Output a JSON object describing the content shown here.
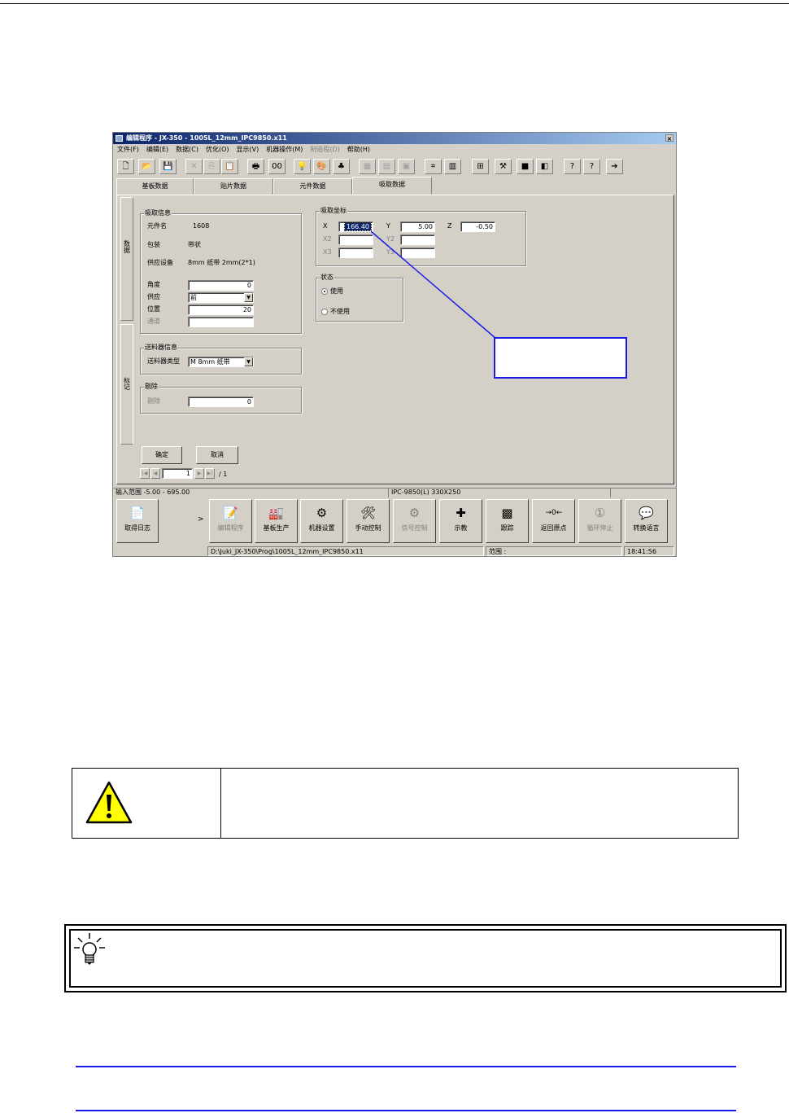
{
  "window": {
    "title": "编辑程序 - JX-350 - 1005L_12mm_IPC9850.x11",
    "close": "×"
  },
  "menu": [
    {
      "label": "文件(F)",
      "enabled": true
    },
    {
      "label": "编辑(E)",
      "enabled": true
    },
    {
      "label": "数据(C)",
      "enabled": true
    },
    {
      "label": "优化(O)",
      "enabled": true
    },
    {
      "label": "显示(V)",
      "enabled": true
    },
    {
      "label": "机器操作(M)",
      "enabled": true
    },
    {
      "label": "制造程(D)",
      "enabled": false
    },
    {
      "label": "帮助(H)",
      "enabled": true
    }
  ],
  "toolbar": [
    {
      "icon": "new-file-icon",
      "glyph": "🗋",
      "enabled": true
    },
    {
      "icon": "open-folder-icon",
      "glyph": "📂",
      "enabled": true
    },
    {
      "icon": "save-icon",
      "glyph": "💾",
      "enabled": true
    },
    {
      "icon": "cut-icon",
      "glyph": "✕",
      "enabled": false
    },
    {
      "icon": "copy-icon",
      "glyph": "⎘",
      "enabled": false
    },
    {
      "icon": "paste-icon",
      "glyph": "📋",
      "enabled": false
    },
    {
      "icon": "print-icon",
      "glyph": "🖶",
      "enabled": true
    },
    {
      "icon": "find-icon",
      "glyph": "00",
      "enabled": true
    },
    {
      "icon": "bulb-icon",
      "glyph": "💡",
      "enabled": true
    },
    {
      "icon": "color-icon",
      "glyph": "🎨",
      "enabled": true
    },
    {
      "icon": "optimize-icon",
      "glyph": "♣",
      "enabled": true
    },
    {
      "icon": "board-icon",
      "glyph": "▦",
      "enabled": false
    },
    {
      "icon": "feeder-icon",
      "glyph": "▤",
      "enabled": false
    },
    {
      "icon": "cube-icon",
      "glyph": "▣",
      "enabled": false
    },
    {
      "icon": "teach-icon",
      "glyph": "⌗",
      "enabled": true
    },
    {
      "icon": "column-icon",
      "glyph": "▥",
      "enabled": true
    },
    {
      "icon": "grid-icon",
      "glyph": "⊞",
      "enabled": true
    },
    {
      "icon": "tool-icon",
      "glyph": "⚒",
      "enabled": true
    },
    {
      "icon": "stop-icon",
      "glyph": "■",
      "enabled": true
    },
    {
      "icon": "layers-icon",
      "glyph": "◧",
      "enabled": true
    },
    {
      "icon": "context-help-icon",
      "glyph": "?",
      "enabled": true
    },
    {
      "icon": "help-icon",
      "glyph": "?",
      "enabled": true
    },
    {
      "icon": "exit-icon",
      "glyph": "➔",
      "enabled": true
    }
  ],
  "tabs": [
    {
      "label": "基板数据",
      "active": false
    },
    {
      "label": "贴片数据",
      "active": false
    },
    {
      "label": "元件数据",
      "active": false
    },
    {
      "label": "吸取数据",
      "active": true
    }
  ],
  "side_tabs": [
    "数据",
    "标记"
  ],
  "pickup_info": {
    "title": "吸取信息",
    "part_name_label": "元件名",
    "part_name_value": "1608",
    "package_label": "包装",
    "package_value": "带状",
    "feeder_device_label": "供应设备",
    "feeder_device_value": "8mm 纸带 2mm(2*1)",
    "angle_label": "角度",
    "angle_value": "0",
    "supply_label": "供应",
    "supply_value": "前",
    "position_label": "位置",
    "position_value": "20",
    "channel_label": "通道",
    "channel_value": ""
  },
  "feeder_info": {
    "title": "送料器信息",
    "type_label": "送料器类型",
    "type_value": "M 8mm 纸带"
  },
  "reject": {
    "title": "剔除",
    "label": "剔除",
    "value": "0"
  },
  "pickup_coords": {
    "title": "吸取坐标",
    "x_label": "X",
    "x_value": "166.40",
    "y_label": "Y",
    "y_value": "5.00",
    "z_label": "Z",
    "z_value": "-0.50",
    "x2_label": "X2",
    "y2_label": "Y2",
    "x3_label": "X3",
    "y3_label": "Y3"
  },
  "status_group": {
    "title": "状态",
    "use_label": "使用",
    "no_use_label": "不使用",
    "selected": "使用"
  },
  "buttons": {
    "ok": "确定",
    "cancel": "取消"
  },
  "pager": {
    "page": "1",
    "total": "/ 1"
  },
  "statusbar": {
    "range": "输入范围 -5.00 - 695.00",
    "board": "IPC-9850(L) 330X250"
  },
  "bottom_buttons": [
    {
      "label": "取得日志",
      "icon": "log-icon",
      "glyph": "📄",
      "enabled": true
    },
    {
      "label": "编辑程序",
      "icon": "edit-program-icon",
      "glyph": "📝",
      "enabled": false
    },
    {
      "label": "基板生产",
      "icon": "production-icon",
      "glyph": "🏭",
      "enabled": true
    },
    {
      "label": "机器设置",
      "icon": "machine-settings-icon",
      "glyph": "⚙",
      "enabled": true
    },
    {
      "label": "手动控制",
      "icon": "manual-control-icon",
      "glyph": "🛠",
      "enabled": true
    },
    {
      "label": "信号控制",
      "icon": "gear-icon",
      "glyph": "⚙",
      "enabled": false
    },
    {
      "label": "示教",
      "icon": "teach-icon",
      "glyph": "✚",
      "enabled": true
    },
    {
      "label": "跟踪",
      "icon": "trace-icon",
      "glyph": "▩",
      "enabled": true
    },
    {
      "label": "返回原点",
      "icon": "home-icon",
      "glyph": "→0←",
      "enabled": true
    },
    {
      "label": "循环停止",
      "icon": "cycle-stop-icon",
      "glyph": "①",
      "enabled": false
    },
    {
      "label": "转换语言",
      "icon": "language-icon",
      "glyph": "💬",
      "enabled": true
    }
  ],
  "expand_arrow": ">",
  "pathbar": {
    "path": "D:\\Juki_JX-350\\Prog\\1005L_12mm_IPC9850.x11",
    "range": "范围 :",
    "time": "18:41:56"
  },
  "colors": {
    "callout_border": "#1a1ae6",
    "titlebar": "#0a246a"
  }
}
